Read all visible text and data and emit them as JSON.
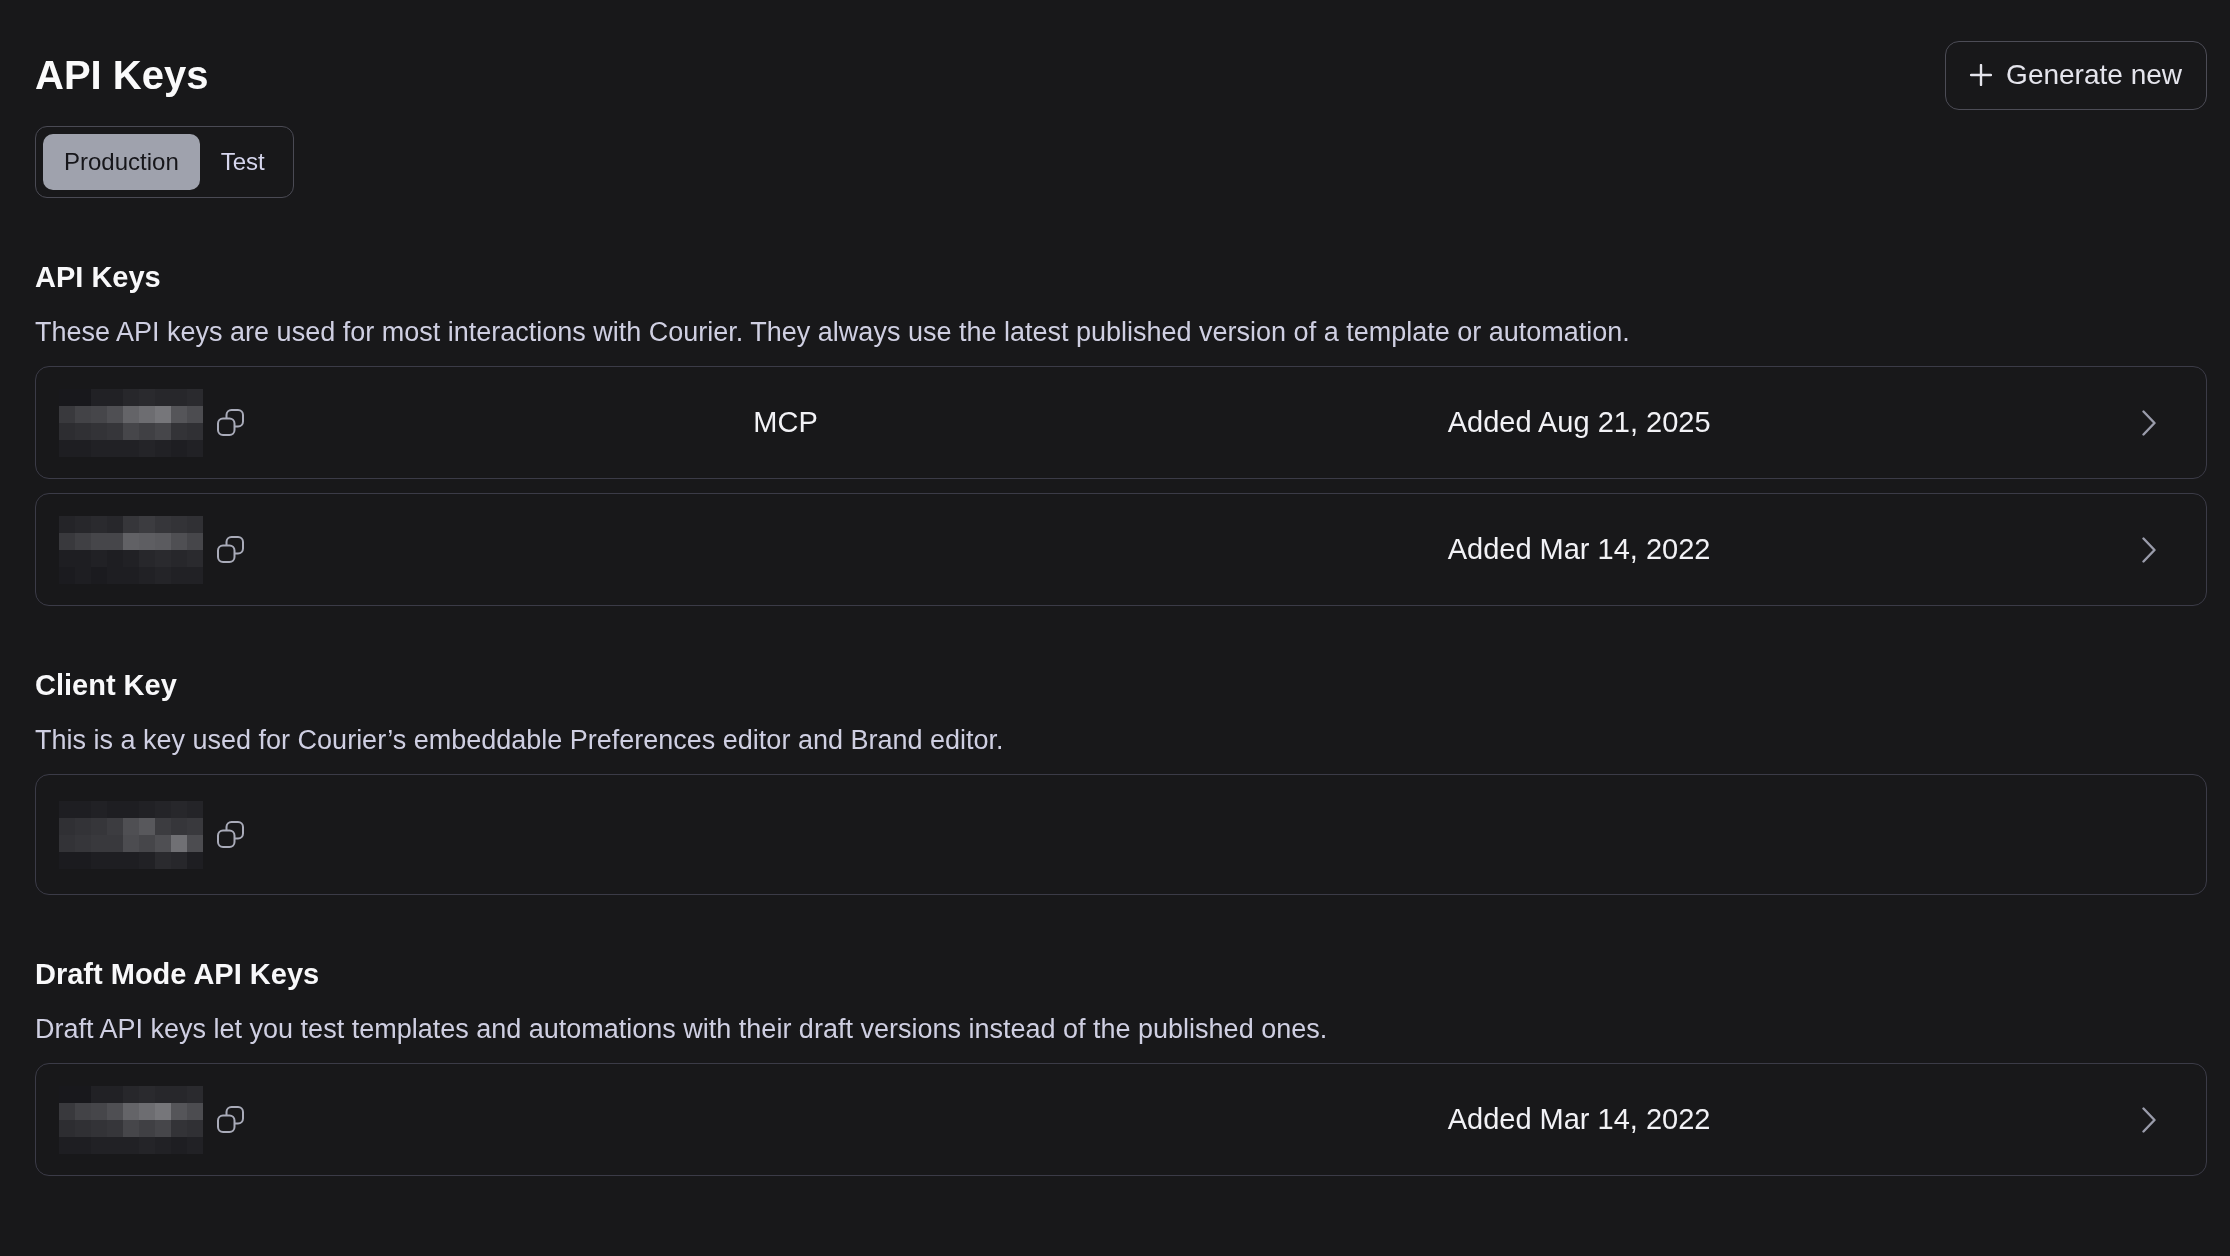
{
  "header": {
    "title": "API Keys",
    "generate_button": {
      "label": "Generate new"
    }
  },
  "tabs": [
    {
      "label": "Production",
      "selected": true
    },
    {
      "label": "Test",
      "selected": false
    }
  ],
  "sections": [
    {
      "heading": "API Keys",
      "description": "These API keys are used for most interactions with Courier. They always use the latest published version of a template or automation.",
      "keys": [
        {
          "kind": "detail",
          "name": "MCP",
          "added": "Added Aug 21, 2025"
        },
        {
          "kind": "detail",
          "added": "Added Mar 14, 2022"
        }
      ]
    },
    {
      "heading": "Client Key",
      "description": "This is a key used for Courier’s embeddable Preferences editor and Brand editor.",
      "keys": [
        {
          "kind": "static"
        }
      ]
    },
    {
      "heading": "Draft Mode API Keys",
      "description": "Draft API keys let you test templates and automations with their draft versions instead of the published ones.",
      "keys": [
        {
          "kind": "detail",
          "added": "Added Mar 14, 2022"
        }
      ]
    }
  ]
}
